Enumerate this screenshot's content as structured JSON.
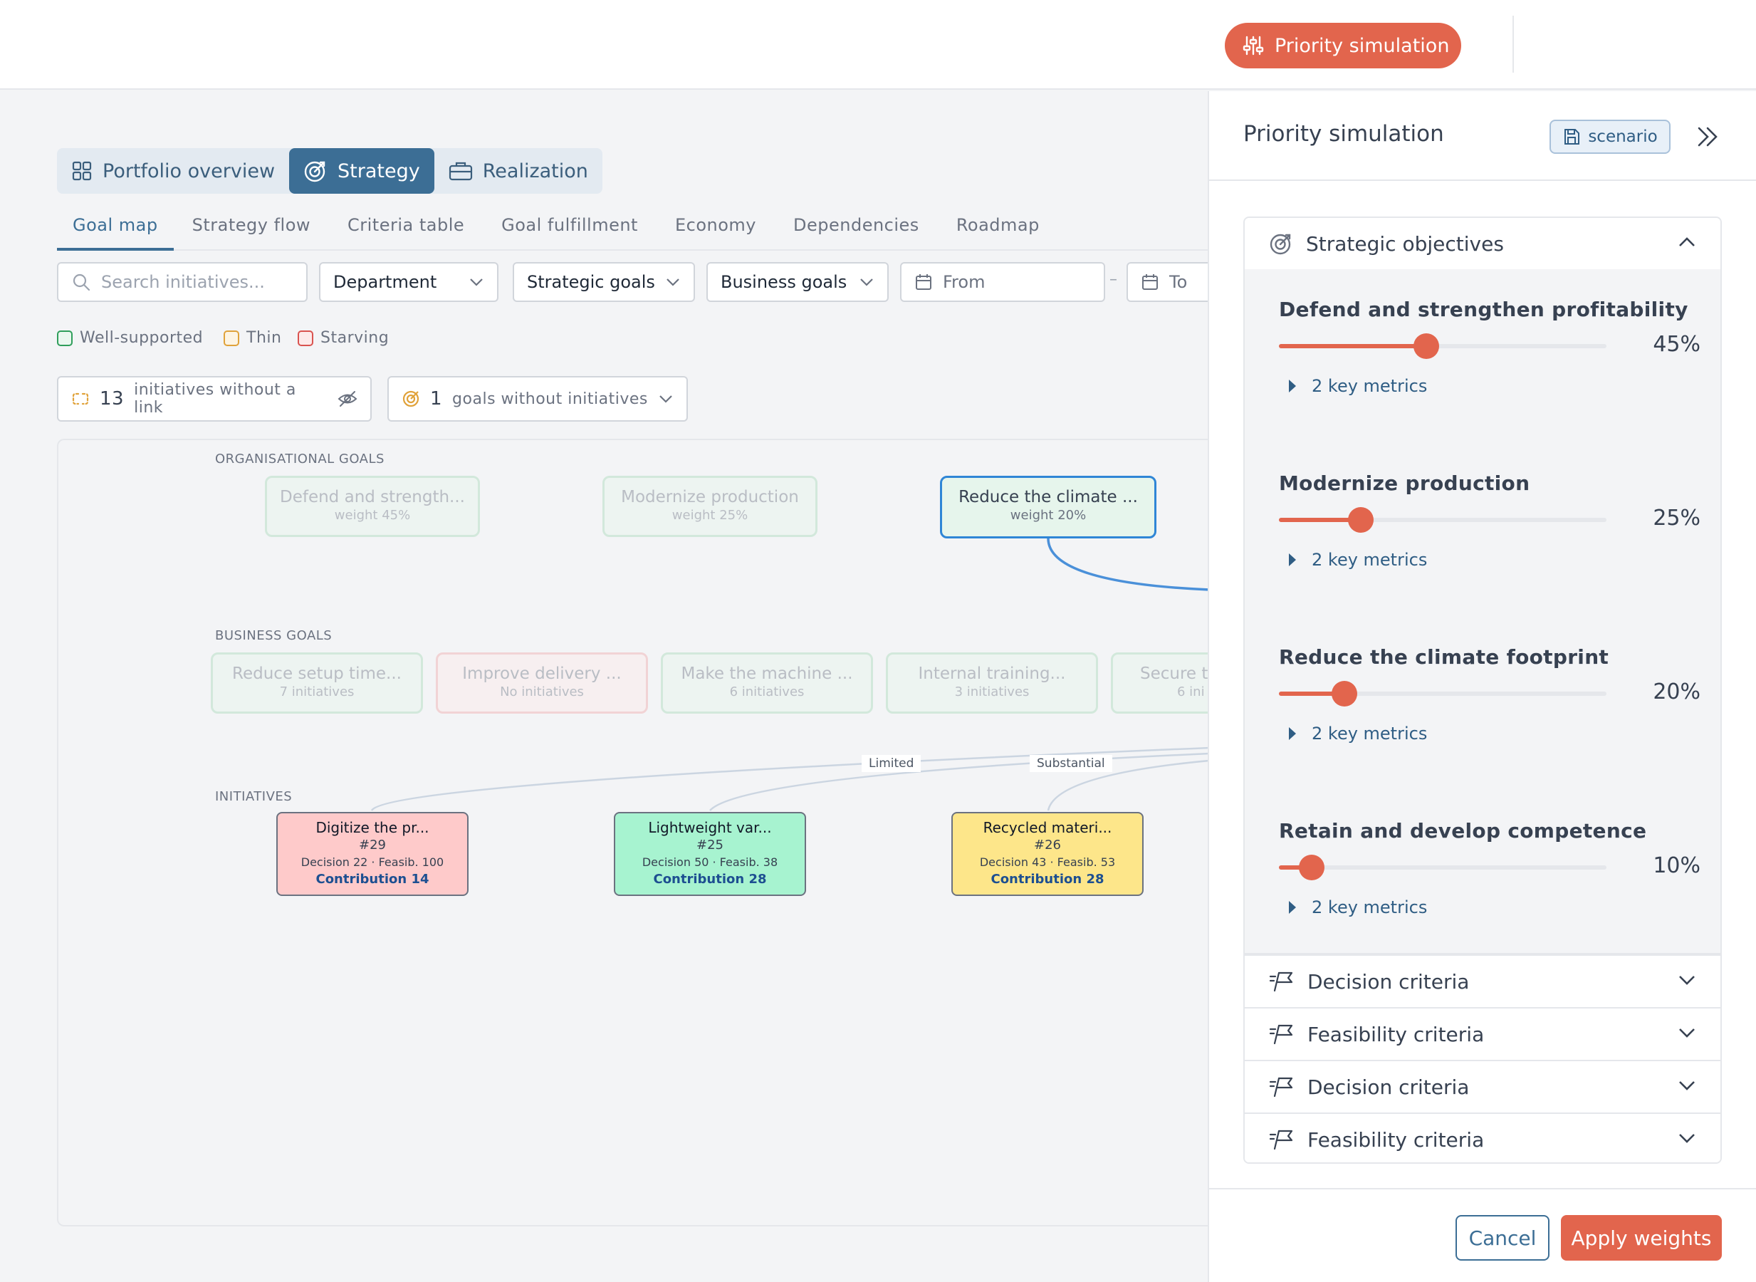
{
  "topbar": {
    "priority_button": "Priority simulation"
  },
  "main_tabs": [
    {
      "label": "Portfolio overview",
      "icon": "grid-icon",
      "active": false
    },
    {
      "label": "Strategy",
      "icon": "target-icon",
      "active": true
    },
    {
      "label": "Realization",
      "icon": "briefcase-icon",
      "active": false
    }
  ],
  "sub_tabs": [
    "Goal map",
    "Strategy flow",
    "Criteria table",
    "Goal fulfillment",
    "Economy",
    "Dependencies",
    "Roadmap"
  ],
  "filters": {
    "search_placeholder": "Search initiatives...",
    "department": "Department",
    "strategic_goals": "Strategic goals",
    "business_goals": "Business goals",
    "from": "From",
    "dash": "–",
    "to": "To"
  },
  "legend": [
    {
      "label": "Well-supported",
      "color": "#2f9e5b"
    },
    {
      "label": "Thin",
      "color": "#e0a23a"
    },
    {
      "label": "Starving",
      "color": "#d9534f"
    }
  ],
  "pills": {
    "unlinked_count": "13",
    "unlinked_text": "initiatives without a link",
    "goals_count": "1",
    "goals_text": "goals without initiatives"
  },
  "canvas": {
    "org_label": "ORGANISATIONAL GOALS",
    "business_label": "BUSINESS GOALS",
    "initiatives_label": "INITIATIVES",
    "org_goals": [
      {
        "title": "Defend and strength...",
        "sub": "weight 45%"
      },
      {
        "title": "Modernize production",
        "sub": "weight 25%"
      },
      {
        "title": "Reduce the climate ...",
        "sub": "weight 20%"
      }
    ],
    "business_goals": [
      {
        "title": "Reduce setup time...",
        "sub": "7 initiatives"
      },
      {
        "title": "Improve delivery ...",
        "sub": "No initiatives"
      },
      {
        "title": "Make the machine ...",
        "sub": "6 initiatives"
      },
      {
        "title": "Internal training...",
        "sub": "3 initiatives"
      },
      {
        "title": "Secure t",
        "sub": "6 ini"
      }
    ],
    "edge_labels": [
      "Limited",
      "Substantial"
    ],
    "initiatives": [
      {
        "title": "Digitize the pr...",
        "num": "#29",
        "detail": "Decision 22 · Feasib. 100",
        "contribution": "Contribution 14",
        "color": "#fecaca"
      },
      {
        "title": "Lightweight var...",
        "num": "#25",
        "detail": "Decision 50 · Feasib. 38",
        "contribution": "Contribution 28",
        "color": "#a7f3d0"
      },
      {
        "title": "Recycled materi...",
        "num": "#26",
        "detail": "Decision 43 · Feasib. 53",
        "contribution": "Contribution 28",
        "color": "#fde68a"
      }
    ]
  },
  "panel": {
    "title": "Priority simulation",
    "scenario_button": "scenario",
    "objectives_header": "Strategic objectives",
    "objectives": [
      {
        "name": "Defend and strengthen profitability",
        "value": 45,
        "label": "45%",
        "metrics": "2 key metrics"
      },
      {
        "name": "Modernize production",
        "value": 25,
        "label": "25%",
        "metrics": "2 key metrics"
      },
      {
        "name": "Reduce the climate footprint",
        "value": 20,
        "label": "20%",
        "metrics": "2 key metrics"
      },
      {
        "name": "Retain and develop competence",
        "value": 10,
        "label": "10%",
        "metrics": "2 key metrics"
      }
    ],
    "criteria_rows": [
      "Decision criteria",
      "Feasibility criteria",
      "Decision criteria",
      "Feasibility criteria"
    ],
    "cancel": "Cancel",
    "apply": "Apply weights"
  },
  "colors": {
    "accent": "#e2654d",
    "primary": "#3c6e95"
  }
}
